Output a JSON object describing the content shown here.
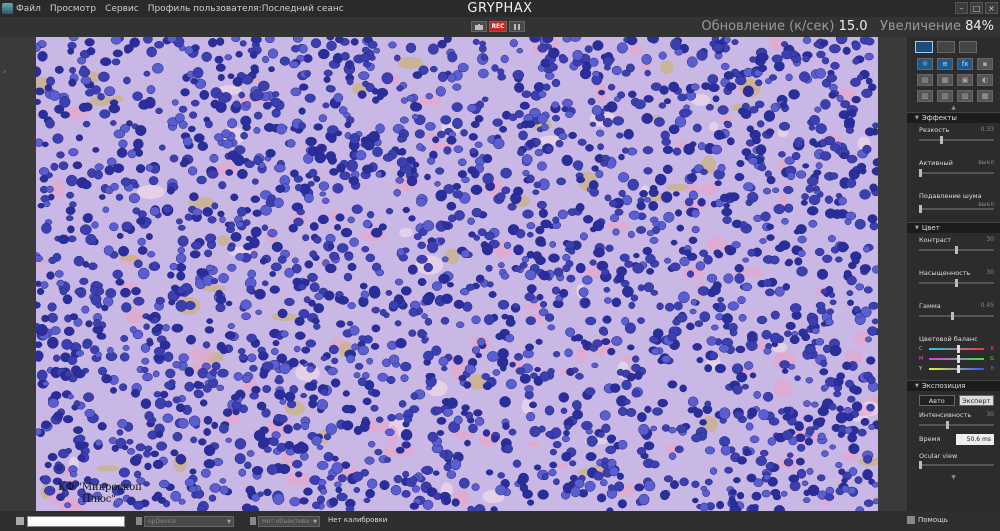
{
  "menu": {
    "items": [
      "Файл",
      "Просмотр",
      "Сервис",
      "Профиль пользователя:Последний сеанс"
    ]
  },
  "app_title": "GRYPHAX",
  "window_controls": [
    "–",
    "□",
    "×"
  ],
  "capture": {
    "rec_label": "REC"
  },
  "status": {
    "refresh_label": "Обновление (к/сек)",
    "refresh_value": "15.0",
    "zoom_label": "Увеличение",
    "zoom_value": "84%"
  },
  "watermark": {
    "line1": "КФ \"Микроскоп",
    "line2": "Плюс\""
  },
  "panel": {
    "effects": {
      "title": "Эффекты",
      "sharpness_label": "Резкость",
      "sharpness_value": "0.33",
      "sharpness_level": 0.33,
      "active_label": "Активный",
      "active_value": "выкл",
      "noise_label": "Подавление шума",
      "noise_value": "выкл"
    },
    "color": {
      "title": "Цвет",
      "contrast_label": "Контраст",
      "contrast_value": "30",
      "saturation_label": "Насыщенность",
      "saturation_value": "30",
      "gamma_label": "Гамма",
      "gamma_value": "0.45",
      "balance_label": "Цветовой баланс",
      "balance_rows": [
        {
          "left": "C",
          "right": "R"
        },
        {
          "left": "M",
          "right": "G"
        },
        {
          "left": "Y",
          "right": "B"
        }
      ]
    },
    "exposure": {
      "title": "Экспозиция",
      "auto_label": "Авто",
      "expert_label": "Эксперт",
      "intensity_label": "Интенсивность",
      "intensity_value": "30",
      "time_label": "Время",
      "time_value": "50.6 ms",
      "ocular_label": "Ocular view"
    }
  },
  "statusbar": {
    "device_placeholder": "opDevice",
    "objective_placeholder": "Нет объектива",
    "calibration": "Нет калибровки",
    "help": "Помощь"
  },
  "colors": {
    "background": "#3a3a3a",
    "panel": "#2c2c2c",
    "rec": "#cc2222",
    "tissue_bg": "#c9b8e6",
    "nucleus": "#3b3fb0"
  }
}
